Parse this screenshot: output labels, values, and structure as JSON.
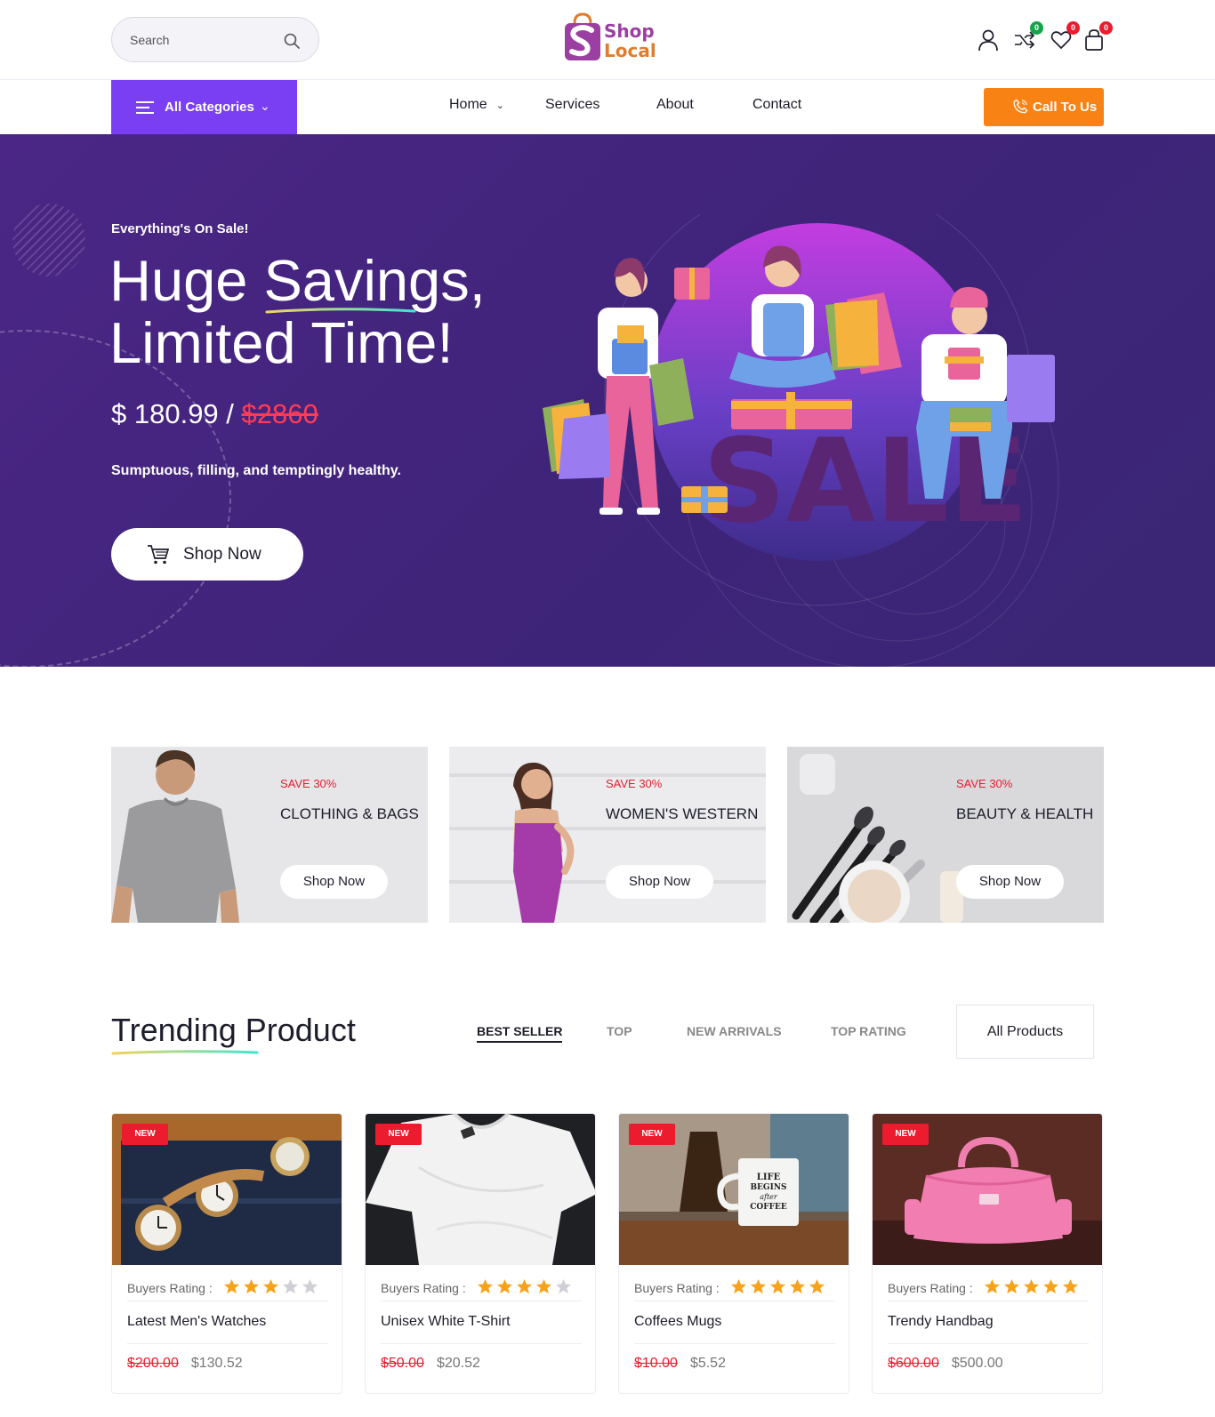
{
  "header": {
    "search_placeholder": "Search",
    "logo": {
      "line1": "Shop",
      "line2": "Local"
    },
    "icons": [
      {
        "name": "user-icon",
        "badge": null
      },
      {
        "name": "compare-shuffle-icon",
        "badge": "0",
        "badge_color": "#16a34a"
      },
      {
        "name": "heart-icon",
        "badge": "0",
        "badge_color": "#ec1b2e"
      },
      {
        "name": "cart-bag-icon",
        "badge": "0",
        "badge_color": "#ec1b2e"
      }
    ]
  },
  "nav": {
    "categories_label": "All Categories",
    "links": [
      "Home",
      "Services",
      "About",
      "Contact"
    ],
    "call_label": "Call To Us"
  },
  "hero": {
    "eyebrow": "Everything's On Sale!",
    "title_line1": "Huge Savings,",
    "title_line2": "Limited Time!",
    "price_new": "$ 180.99 / ",
    "price_old": "$2860",
    "subtitle": "Sumptuous, filling, and temptingly healthy.",
    "button": "Shop Now",
    "art_text": "SALE"
  },
  "banners": [
    {
      "save": "SAVE 30%",
      "name": "CLOTHING & BAGS",
      "button": "Shop Now"
    },
    {
      "save": "SAVE 30%",
      "name": "WOMEN'S WESTERN",
      "button": "Shop Now"
    },
    {
      "save": "SAVE 30%",
      "name": "BEAUTY & HEALTH",
      "button": "Shop Now"
    }
  ],
  "trending": {
    "title": "Trending Product",
    "tabs": [
      "BEST SELLER",
      "TOP",
      "NEW ARRIVALS",
      "TOP RATING"
    ],
    "active_tab": "BEST SELLER",
    "all_products": "All Products",
    "rating_label": "Buyers Rating :",
    "products": [
      {
        "badge": "NEW",
        "name": "Latest Men's Watches",
        "old_price": "$200.00",
        "price": "$130.52",
        "rating": 3
      },
      {
        "badge": "NEW",
        "name": "Unisex White T-Shirt",
        "old_price": "$50.00",
        "price": "$20.52",
        "rating": 4
      },
      {
        "badge": "NEW",
        "name": "Coffees Mugs",
        "old_price": "$10.00",
        "price": "$5.52",
        "rating": 5,
        "mug_text": [
          "LIFE",
          "BEGINS",
          "after",
          "COFFEE"
        ]
      },
      {
        "badge": "NEW",
        "name": "Trendy Handbag",
        "old_price": "$600.00",
        "price": "$500.00",
        "rating": 5
      }
    ]
  },
  "colors": {
    "accent_purple": "#7a3ff2",
    "accent_orange": "#f98214",
    "hero_bg": "#43257e",
    "sale_red": "#ec1b2e",
    "star": "#f7a21b"
  }
}
